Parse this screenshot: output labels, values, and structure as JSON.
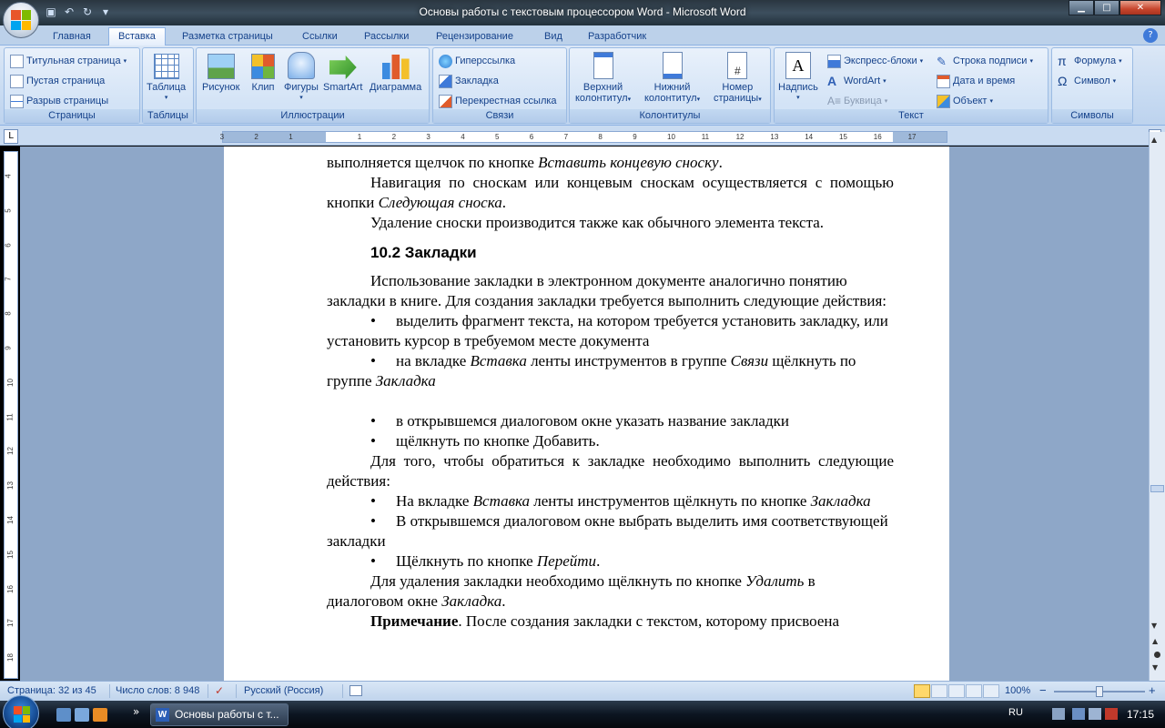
{
  "window": {
    "title": "Основы работы с текстовым процессором Word - Microsoft Word",
    "minimize": "▁",
    "maximize": "□",
    "close": "✕"
  },
  "qat": {
    "save_icon": "save-icon",
    "undo_icon": "undo-icon",
    "redo_icon": "redo-icon",
    "more_icon": "chevron-down-icon"
  },
  "tabs": [
    {
      "label": "Главная"
    },
    {
      "label": "Вставка",
      "active": true
    },
    {
      "label": "Разметка страницы"
    },
    {
      "label": "Ссылки"
    },
    {
      "label": "Рассылки"
    },
    {
      "label": "Рецензирование"
    },
    {
      "label": "Вид"
    },
    {
      "label": "Разработчик"
    }
  ],
  "help_label": "?",
  "ribbon": {
    "pages": {
      "label": "Страницы",
      "title_page": "Титульная страница",
      "blank_page": "Пустая страница",
      "page_break": "Разрыв страницы"
    },
    "tables": {
      "label": "Таблицы",
      "table": "Таблица"
    },
    "illustrations": {
      "label": "Иллюстрации",
      "picture": "Рисунок",
      "clip": "Клип",
      "shapes": "Фигуры",
      "smartart": "SmartArt",
      "chart": "Диаграмма"
    },
    "links": {
      "label": "Связи",
      "hyperlink": "Гиперссылка",
      "bookmark": "Закладка",
      "cross_ref": "Перекрестная ссылка"
    },
    "headers": {
      "label": "Колонтитулы",
      "header_1": "Верхний",
      "header_2": "колонтитул",
      "footer_1": "Нижний",
      "footer_2": "колонтитул",
      "pagenum_1": "Номер",
      "pagenum_2": "страницы"
    },
    "text": {
      "label": "Текст",
      "textbox": "Надпись",
      "quickparts": "Экспресс-блоки",
      "wordart": "WordArt",
      "dropcap": "Буквица",
      "signature": "Строка подписи",
      "datetime": "Дата и время",
      "object": "Объект"
    },
    "symbols": {
      "label": "Символы",
      "equation": "Формула",
      "symbol": "Символ"
    }
  },
  "tab_selector": "L",
  "ruler_ticks": [
    "3",
    "2",
    "1",
    "1",
    "2",
    "3",
    "4",
    "5",
    "6",
    "7",
    "8",
    "9",
    "10",
    "11",
    "12",
    "13",
    "14",
    "15",
    "16",
    "17"
  ],
  "vruler_ticks": [
    "4",
    "5",
    "6",
    "7",
    "8",
    "9",
    "10",
    "11",
    "12",
    "13",
    "14",
    "15",
    "16",
    "17",
    "18"
  ],
  "document": {
    "p1": "выполняется щелчок по кнопке ",
    "p1_it": "Вставить концевую сноску",
    "p1_end": ".",
    "p2": "Навигация по сноскам или концевым сноскам осуществляется с помощью кнопки ",
    "p2_it": "Следующая сноска",
    "p2_end": ".",
    "p3": "Удаление сноски производится также как обычного элемента текста.",
    "heading": "10.2 Закладки",
    "p4": "Использование закладки в электронном документе аналогично понятию закладки в книге. Для создания закладки требуется выполнить следующие действия:",
    "bullet": "•",
    "b1": "выделить фрагмент текста, на котором требуется установить закладку, или установить курсор в требуемом месте документа",
    "b2_a": "на вкладке ",
    "b2_it1": "Вставка",
    "b2_b": " ленты инструментов в группе ",
    "b2_it2": "Связи",
    "b2_c": " щёлкнуть по группе ",
    "b2_it3": "Закладка",
    "b3": "в открывшемся диалоговом окне указать название закладки",
    "b4": "щёлкнуть по кнопке Добавить.",
    "p5": "Для того, чтобы обратиться к закладке необходимо выполнить следующие действия:",
    "b5_a": "На вкладке ",
    "b5_it1": "Вставка",
    "b5_b": " ленты инструментов щёлкнуть по кнопке ",
    "b5_it2": "Закладка",
    "b6": "В открывшемся диалоговом окне выбрать выделить имя соответствующей закладки",
    "b7_a": "Щёлкнуть по кнопке ",
    "b7_it": "Перейти",
    "b7_end": ".",
    "p6_a": "Для удаления закладки необходимо щёлкнуть по кнопке ",
    "p6_it1": "Удалить",
    "p6_b": " в диалоговом окне ",
    "p6_it2": "Закладка",
    "p6_end": ".",
    "p7_bold": "Примечание",
    "p7": ". После создания закладки с текстом, которому присвоена"
  },
  "status": {
    "page": "Страница: 32 из 45",
    "words": "Число слов: 8 948",
    "language": "Русский (Россия)",
    "zoom": "100%",
    "zoom_minus": "−",
    "zoom_plus": "+"
  },
  "taskbar": {
    "task_label": "Основы работы с т...",
    "task_icon": "W",
    "more": "»",
    "lang": "RU",
    "time": "17:15"
  }
}
